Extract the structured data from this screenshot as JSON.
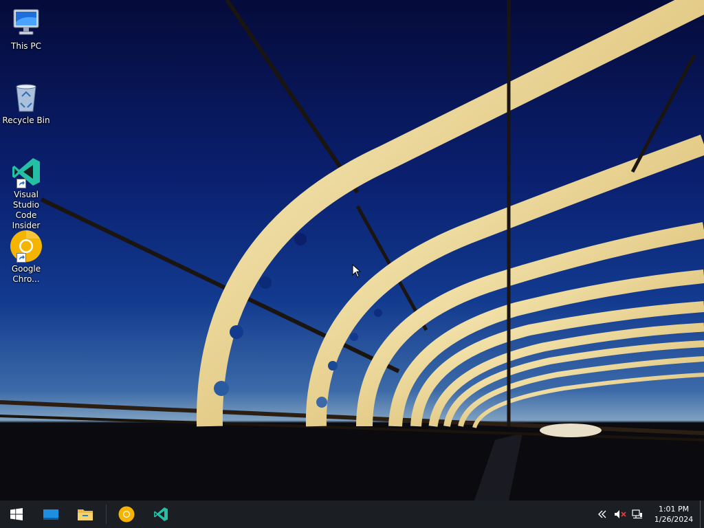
{
  "desktop": {
    "icons": [
      {
        "label": "This PC",
        "icon": "this-pc-icon"
      },
      {
        "label": "Recycle Bin",
        "icon": "recycle-bin-icon"
      },
      {
        "label": "Visual Studio Code Insider",
        "icon": "vscode-insiders-icon",
        "shortcut": true
      },
      {
        "label": "Google Chro...",
        "icon": "chrome-canary-icon",
        "shortcut": true
      }
    ]
  },
  "taskbar": {
    "pinned": [
      "start-icon",
      "task-view-icon",
      "file-explorer-icon",
      "chrome-canary-icon",
      "vscode-insiders-icon"
    ],
    "tray": [
      "show-hidden-icons-chevron",
      "volume-muted-icon",
      "network-icon"
    ],
    "clock": {
      "time": "1:01 PM",
      "date": "1/26/2024"
    }
  },
  "colors": {
    "taskbar": "#1b1f24",
    "vscode_insiders": "#24bfa5",
    "chrome_canary": "#f4b400"
  }
}
